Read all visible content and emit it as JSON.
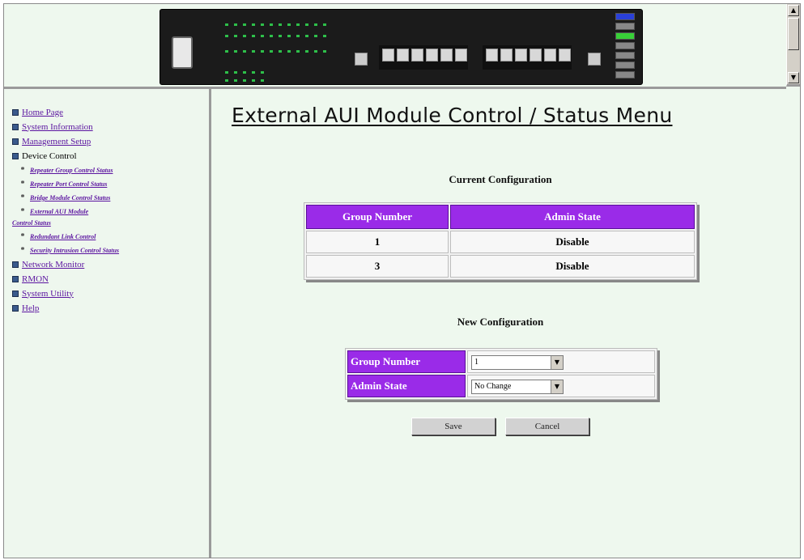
{
  "header": {
    "device_image": "ethernet-hub-switch-front-panel",
    "scrollbar": {
      "up_arrow": "▲",
      "down_arrow": "▼"
    }
  },
  "nav": {
    "items": [
      {
        "label": "Home Page",
        "link": true
      },
      {
        "label": "System Information",
        "link": true
      },
      {
        "label": "Management Setup",
        "link": true
      },
      {
        "label": "Device Control",
        "link": false
      },
      {
        "label": "Network Monitor",
        "link": true
      },
      {
        "label": "RMON",
        "link": true
      },
      {
        "label": "System Utility",
        "link": true
      },
      {
        "label": "Help",
        "link": true
      }
    ],
    "device_control_sub": [
      "Repeater Group Control Status",
      "Repeater Port Control Status",
      "Bridge Module Control Status",
      "External AUI Module",
      "Control Status",
      "Redundant Link Control",
      "Security Intrusion Control Status"
    ],
    "star": "*"
  },
  "main": {
    "title": "External AUI Module Control / Status Menu",
    "current": {
      "heading": "Current Configuration",
      "columns": [
        "Group Number",
        "Admin State"
      ],
      "rows": [
        [
          "1",
          "Disable"
        ],
        [
          "3",
          "Disable"
        ]
      ]
    },
    "new": {
      "heading": "New Configuration",
      "group_label": "Group Number",
      "group_value": "1",
      "admin_label": "Admin State",
      "admin_value": "No Change",
      "dropdown_arrow": "▼"
    },
    "buttons": {
      "save": "Save",
      "cancel": "Cancel"
    }
  },
  "colors": {
    "table_header": "#9a2be8",
    "link": "#5b14a0",
    "background": "#eef8ee"
  }
}
